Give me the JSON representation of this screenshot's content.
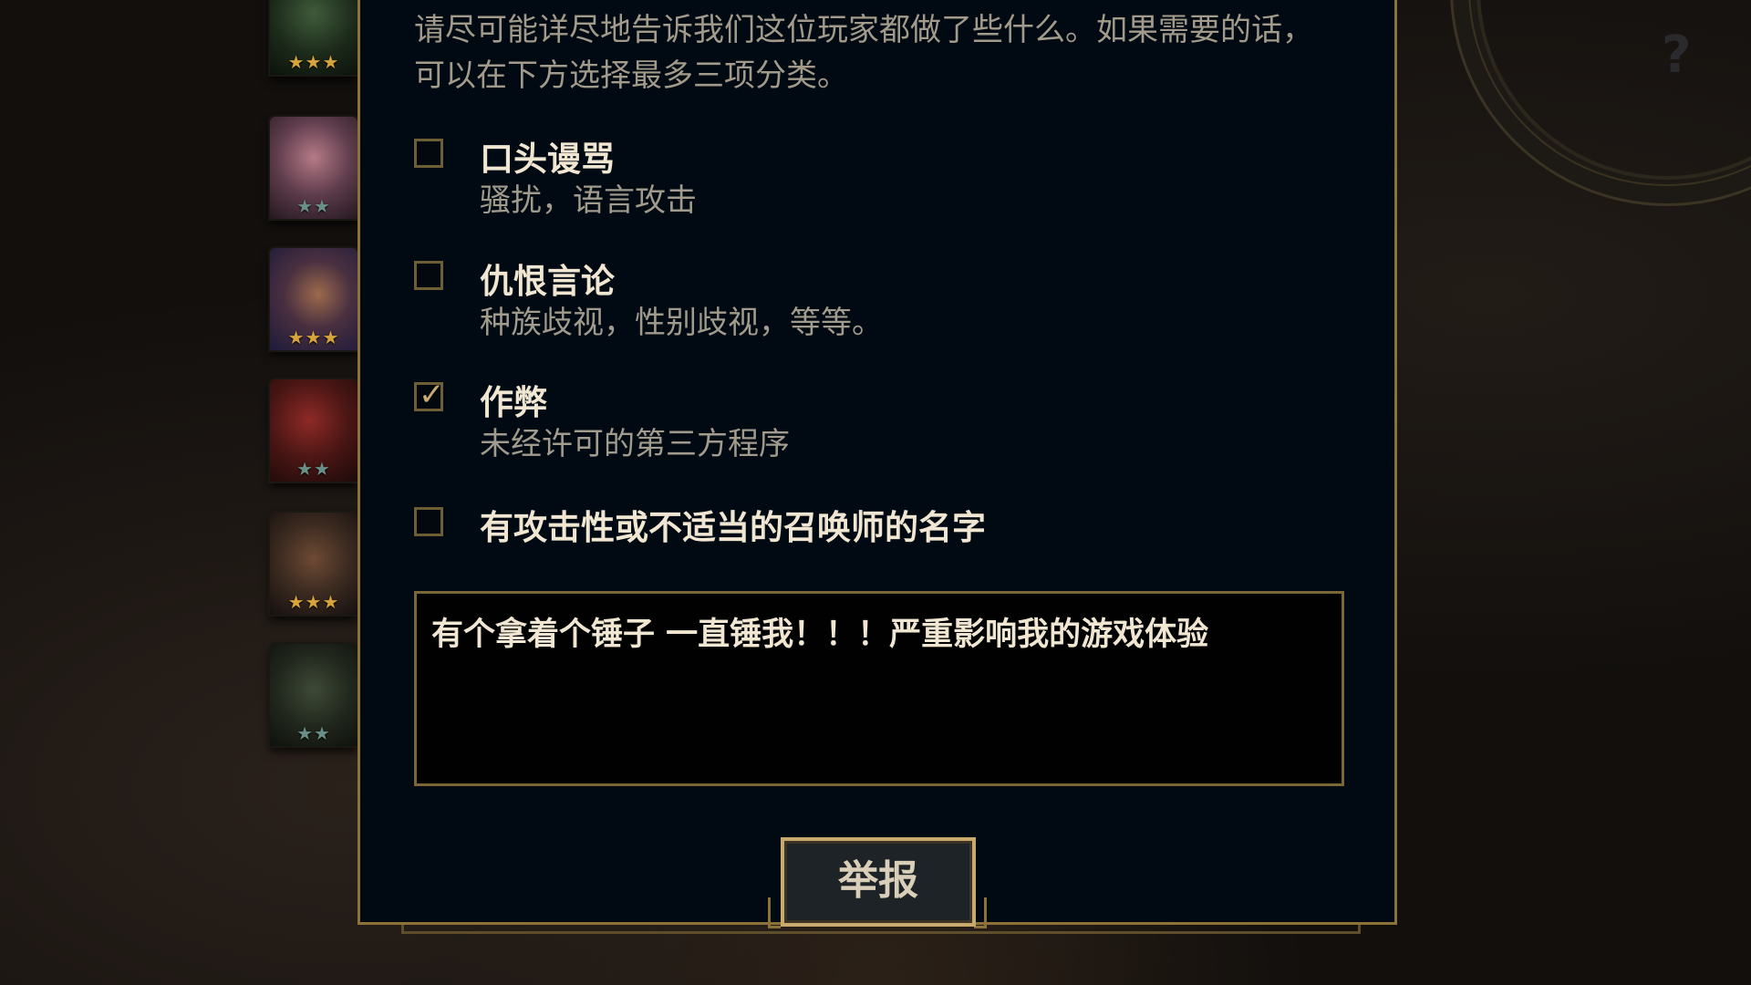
{
  "instructions": "请尽可能详尽地告诉我们这位玩家都做了些什么。如果需要的话，可以在下方选择最多三项分类。",
  "background": {
    "corner_help": "?",
    "portraits": [
      {
        "stars": "★★★",
        "star_color": "gold"
      },
      {
        "stars": "★★",
        "star_color": "teal"
      },
      {
        "stars": "★★★",
        "star_color": "gold"
      },
      {
        "stars": "★★",
        "star_color": "teal"
      },
      {
        "stars": "★★★",
        "star_color": "gold"
      },
      {
        "stars": "★★",
        "star_color": "teal"
      }
    ]
  },
  "options": [
    {
      "title": "口头谩骂",
      "desc": "骚扰，语言攻击",
      "checked": false
    },
    {
      "title": "仇恨言论",
      "desc": "种族歧视，性别歧视，等等。",
      "checked": false
    },
    {
      "title": "作弊",
      "desc": "未经许可的第三方程序",
      "checked": true
    },
    {
      "title": "有攻击性或不适当的召唤师的名字",
      "desc": "",
      "checked": false
    }
  ],
  "check_glyph": "✓",
  "comment": "有个拿着个锤子 一直锤我！！！严重影响我的游戏体验",
  "report_button": "举报",
  "colors": {
    "dialog_bg": "#010913",
    "gold_border": "#8c7238",
    "gold_accent": "#c8aa6e",
    "title_text": "#f0e6d2",
    "desc_text": "#a09b8c"
  }
}
